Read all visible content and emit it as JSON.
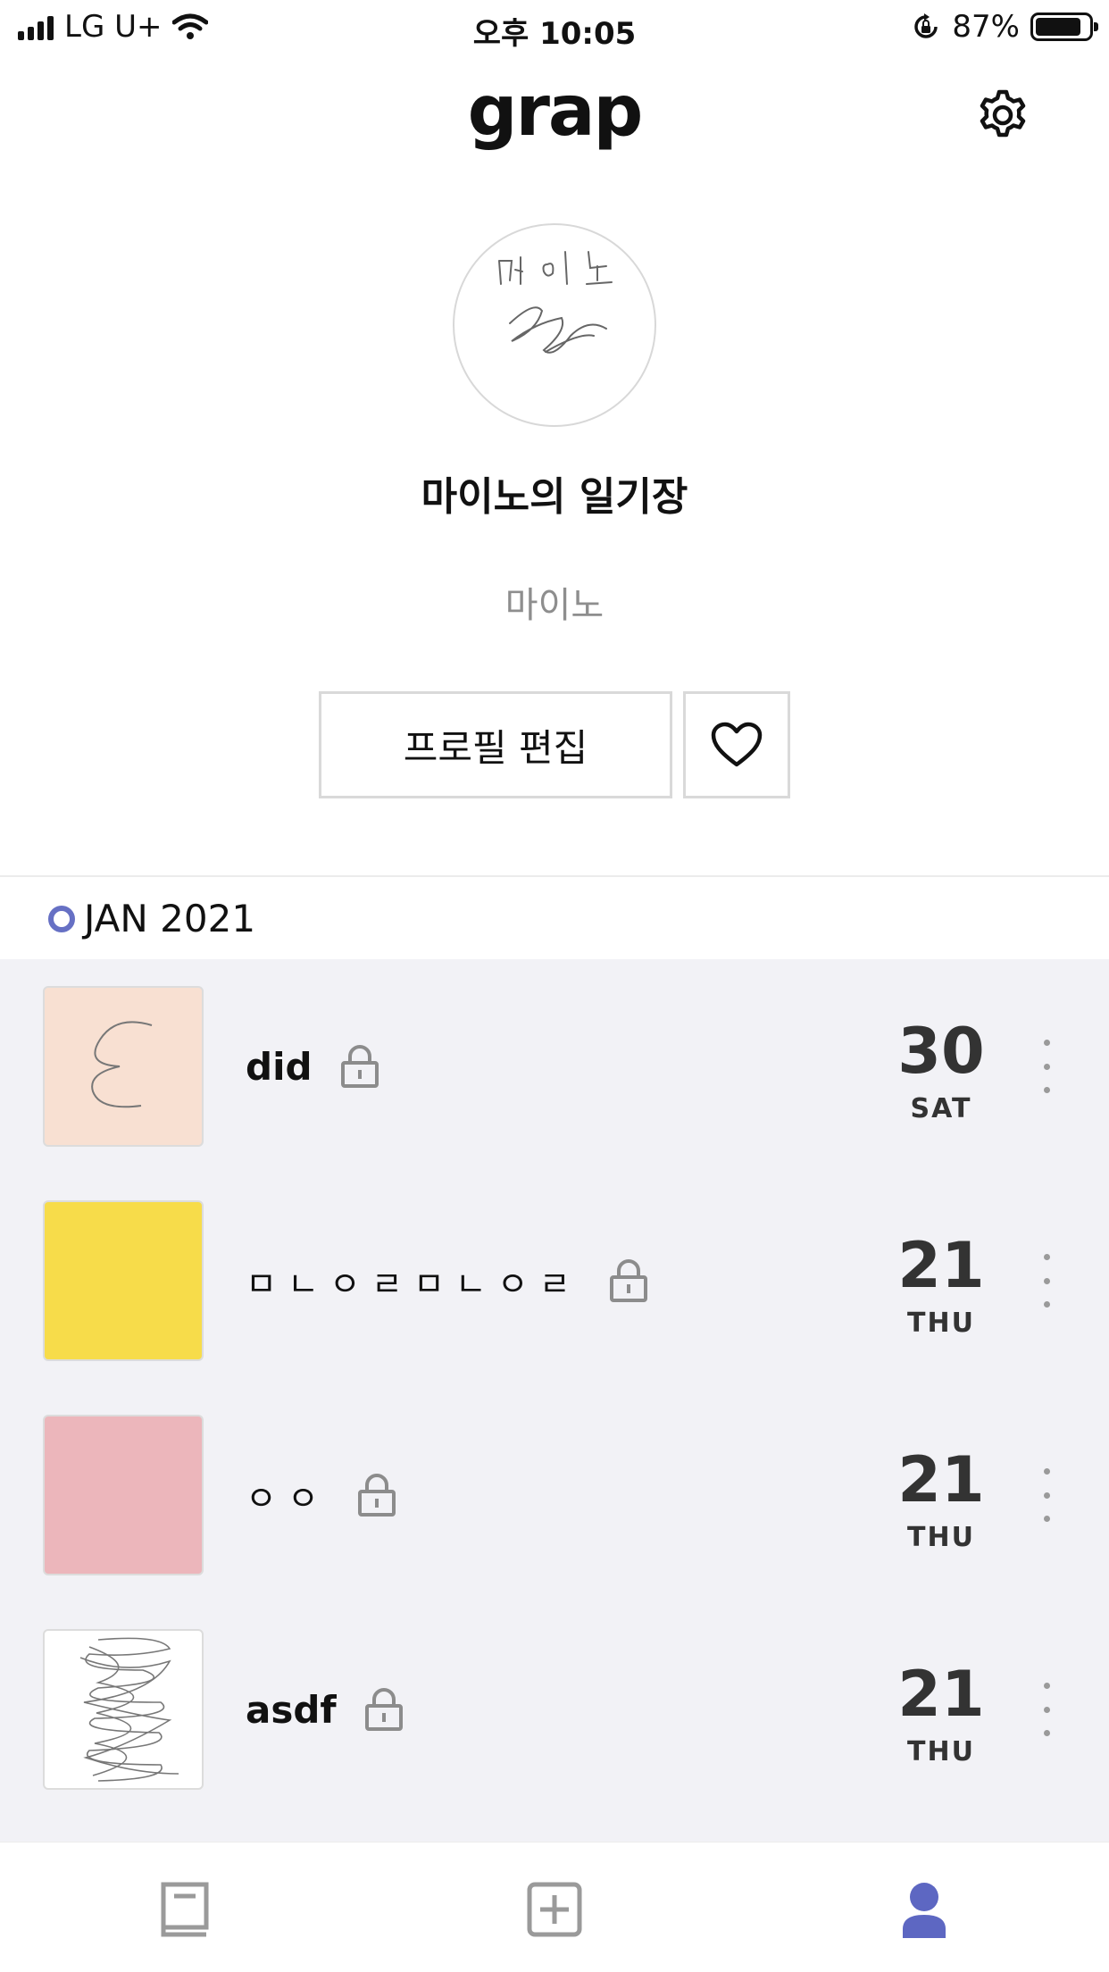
{
  "status_bar": {
    "carrier": "LG U+",
    "time": "오후 10:05",
    "battery_percent": "87%",
    "battery_level": 0.87,
    "icons": [
      "signal-icon",
      "wifi-icon",
      "rotation-lock-icon",
      "battery-icon"
    ]
  },
  "header": {
    "logo": "grap",
    "settings_icon": "gear-icon"
  },
  "profile": {
    "avatar_icon": "handwritten-avatar",
    "title": "마이노의 일기장",
    "name": "마이노",
    "edit_button_label": "프로필 편집",
    "favorite_icon": "heart-icon"
  },
  "section": {
    "month": "JAN 2021",
    "accent_color": "#6670c4"
  },
  "entries": [
    {
      "title": "did",
      "date": "30",
      "day": "SAT",
      "thumb_color": "#f8e0d2",
      "locked": true,
      "thumb_icon": "scribble-drawing"
    },
    {
      "title": "ㅁㄴㅇㄹㅁㄴㅇㄹ",
      "date": "21",
      "day": "THU",
      "thumb_color": "#f7dc4a",
      "locked": true,
      "thumb_icon": ""
    },
    {
      "title": "ㅇㅇ",
      "date": "21",
      "day": "THU",
      "thumb_color": "#ecb6bb",
      "locked": true,
      "thumb_icon": ""
    },
    {
      "title": "asdf",
      "date": "21",
      "day": "THU",
      "thumb_color": "#ffffff",
      "locked": true,
      "thumb_icon": "scribble-drawing"
    }
  ],
  "tab_bar": {
    "tabs": [
      {
        "icon": "diary-book-icon",
        "active": false
      },
      {
        "icon": "add-square-icon",
        "active": false
      },
      {
        "icon": "profile-person-icon",
        "active": true
      }
    ],
    "active_color": "#5d67c2",
    "inactive_color": "#9a9a9a"
  }
}
